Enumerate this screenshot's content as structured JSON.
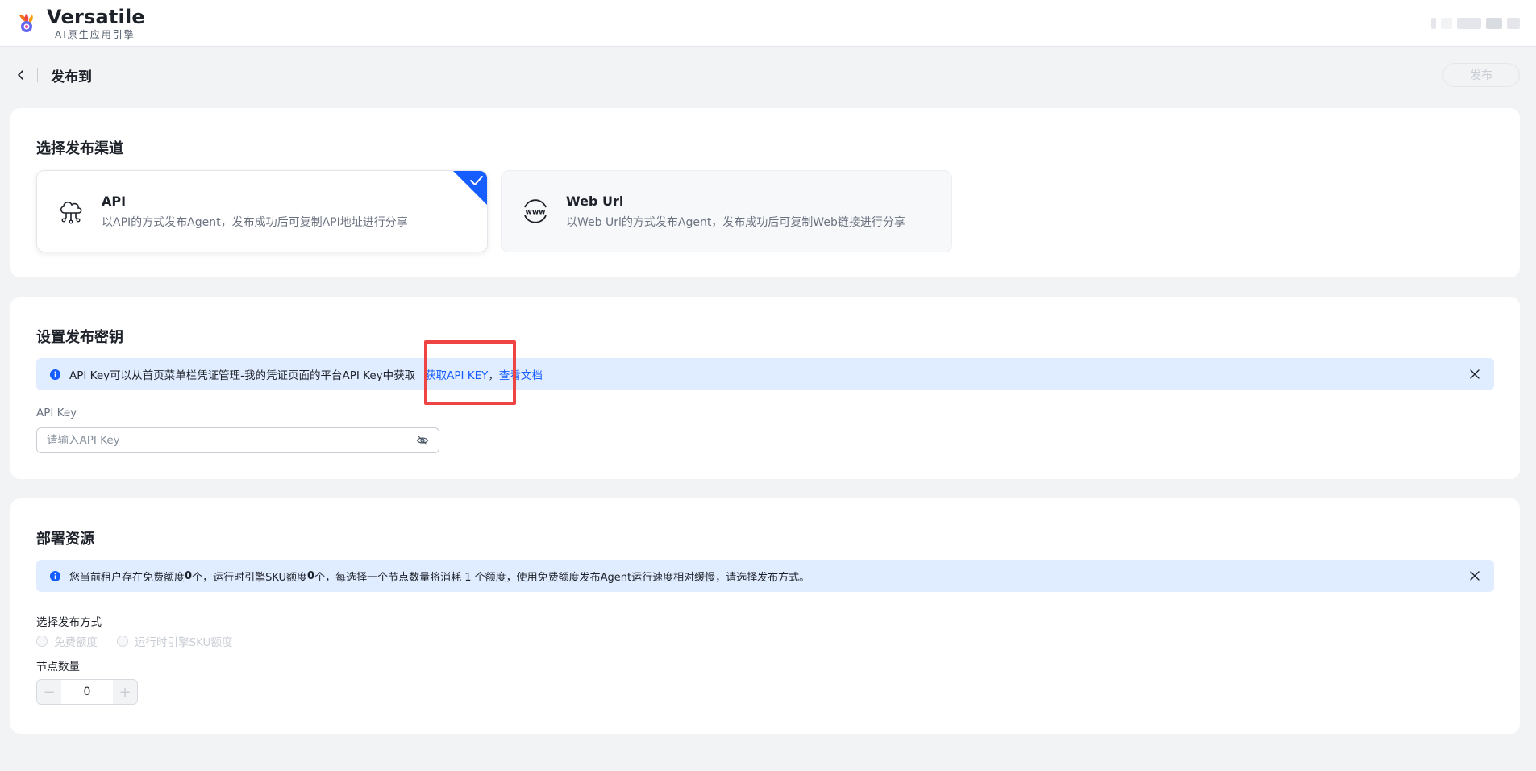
{
  "header": {
    "brand_name": "Versatile",
    "brand_sub": "AI原生应用引擎"
  },
  "pagebar": {
    "title": "发布到",
    "publish_label": "发布"
  },
  "channel_section": {
    "title": "选择发布渠道",
    "channels": [
      {
        "name": "API",
        "desc": "以API的方式发布Agent，发布成功后可复制API地址进行分享",
        "selected": true
      },
      {
        "name": "Web Url",
        "desc": "以Web Url的方式发布Agent，发布成功后可复制Web链接进行分享",
        "selected": false
      }
    ]
  },
  "key_section": {
    "title": "设置发布密钥",
    "alert_text": "API Key可以从首页菜单栏凭证管理-我的凭证页面的平台API Key中获取",
    "link_get_key": "获取API KEY",
    "separator": "，",
    "link_docs": "查看文档",
    "field_label": "API Key",
    "placeholder": "请输入API Key",
    "value": ""
  },
  "deploy_section": {
    "title": "部署资源",
    "alert_prefix": "您当前租户存在免费额度",
    "free_quota": "0",
    "alert_mid1": "个，运行时引擎SKU额度",
    "sku_quota": "0",
    "alert_mid2": "个，每选择一个节点数量将消耗 1 个额度，使用免费额度发布Agent运行速度相对缓慢，请选择发布方式。",
    "method_label": "选择发布方式",
    "methods": [
      "免费额度",
      "运行时引擎SKU额度"
    ],
    "node_label": "节点数量",
    "node_minus": "−",
    "node_value": "0",
    "node_plus": "+"
  },
  "colors": {
    "accent": "#165dff",
    "alert_bg": "#e0ecff",
    "highlight": "#ef4444"
  }
}
